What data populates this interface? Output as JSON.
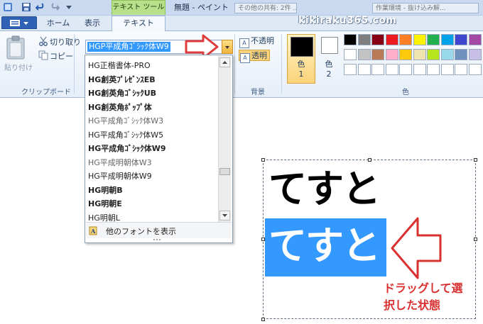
{
  "title_bar": {
    "context_tab": "テキスト ツール",
    "window_title": "無題 - ペイント",
    "bg_windows": [
      "その他の共有: 2件 ...",
      "作業環境 - 抜け込み解..."
    ]
  },
  "watermark": "kikiraku365.com",
  "tabs": {
    "home": "ホーム",
    "view": "表示",
    "text": "テキスト"
  },
  "clipboard": {
    "paste": "貼り付け",
    "cut": "切り取り",
    "copy": "コピー",
    "group_label": "クリップボード"
  },
  "font": {
    "selected": "HGP平成角ｺﾞｼｯｸ体W9",
    "options": [
      {
        "label": "HG正楷書体-PRO",
        "style": "normal"
      },
      {
        "label": "HG創英ﾌﾟﾚｾﾞﾝｽEB",
        "style": "bold"
      },
      {
        "label": "HG創英角ｺﾞｼｯｸUB",
        "style": "bold"
      },
      {
        "label": "HG創英角ﾎﾟｯﾌﾟ体",
        "style": "bold"
      },
      {
        "label": "HG平成角ｺﾞｼｯｸ体W3",
        "style": "light"
      },
      {
        "label": "HG平成角ｺﾞｼｯｸ体W5",
        "style": "normal"
      },
      {
        "label": "HG平成角ｺﾞｼｯｸ体W9",
        "style": "bold"
      },
      {
        "label": "HG平成明朝体W3",
        "style": "light"
      },
      {
        "label": "HG平成明朝体W9",
        "style": "normal"
      },
      {
        "label": "HG明朝B",
        "style": "bold"
      },
      {
        "label": "HG明朝E",
        "style": "bold"
      },
      {
        "label": "HG明朝L",
        "style": "normal"
      }
    ],
    "more_fonts": "他のフォントを表示"
  },
  "background": {
    "opaque": "不透明",
    "transparent": "透明",
    "group_label": "背景"
  },
  "colors": {
    "color1_label": "色\n1",
    "color2_label": "色\n2",
    "group_label": "色",
    "palette_row1": [
      "#000000",
      "#7f7f7f",
      "#880015",
      "#ed1c24",
      "#ff7f27",
      "#fff200",
      "#22b14c",
      "#00a2e8",
      "#3f48cc",
      "#a349a4"
    ],
    "palette_row2": [
      "#ffffff",
      "#c3c3c3",
      "#b97a57",
      "#ffaec9",
      "#ffc90e",
      "#efe4b0",
      "#b5e61d",
      "#99d9ea",
      "#7092be",
      "#c8bfe7"
    ],
    "palette_row3": [
      "#ffffff",
      "#ffffff",
      "#ffffff",
      "#ffffff",
      "#ffffff",
      "#ffffff",
      "#ffffff",
      "#ffffff",
      "#ffffff",
      "#ffffff"
    ]
  },
  "canvas": {
    "line1": "てすと",
    "line2_selected": "てすと"
  },
  "annotation": {
    "line1": "ドラッグして選",
    "line2": "択した状態",
    "color": "#d93030"
  }
}
